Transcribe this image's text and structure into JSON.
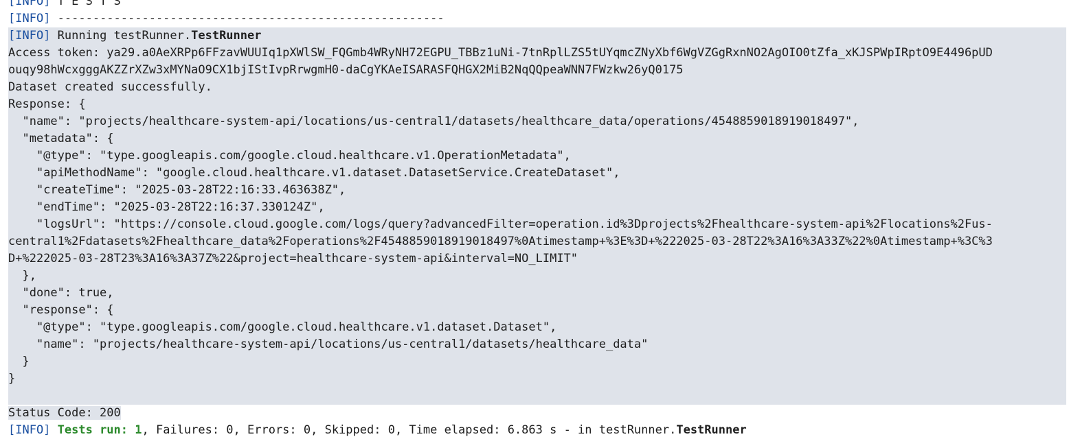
{
  "console": {
    "info_tag": "[INFO]",
    "header_tests": " T E S T S",
    "header_rule": " -------------------------------------------------------",
    "running_prefix": " Running testRunner.",
    "running_class": "TestRunner",
    "lines": [
      "Access token: ya29.a0AeXRPp6FFzavWUUIq1pXWlSW_FQGmb4WRyNH72EGPU_TBBz1uNi-7tnRplLZS5tUYqmcZNyXbf6WgVZGgRxnNO2AgOIO0tZfa_xKJSPWpIRptO9E4496pUD",
      "ouqy98hWcxgggAKZZrXZw3xMYNaO9CX1bjIStIvpRrwgmH0-daCgYKAeISARASFQHGX2MiB2NqQQpeaWNN7FWzkw26yQ0175",
      "Dataset created successfully.",
      "Response: {",
      "  \"name\": \"projects/healthcare-system-api/locations/us-central1/datasets/healthcare_data/operations/4548859018919018497\",",
      "  \"metadata\": {",
      "    \"@type\": \"type.googleapis.com/google.cloud.healthcare.v1.OperationMetadata\",",
      "    \"apiMethodName\": \"google.cloud.healthcare.v1.dataset.DatasetService.CreateDataset\",",
      "    \"createTime\": \"2025-03-28T22:16:33.463638Z\",",
      "    \"endTime\": \"2025-03-28T22:16:37.330124Z\",",
      "    \"logsUrl\": \"https://console.cloud.google.com/logs/query?advancedFilter=operation.id%3Dprojects%2Fhealthcare-system-api%2Flocations%2Fus-",
      "central1%2Fdatasets%2Fhealthcare_data%2Foperations%2F4548859018919018497%0Atimestamp+%3E%3D+%222025-03-28T22%3A16%3A33Z%22%0Atimestamp+%3C%3",
      "D+%222025-03-28T23%3A16%3A37Z%22&project=healthcare-system-api&interval=NO_LIMIT\"",
      "  },",
      "  \"done\": true,",
      "  \"response\": {",
      "    \"@type\": \"type.googleapis.com/google.cloud.healthcare.v1.dataset.Dataset\",",
      "    \"name\": \"projects/healthcare-system-api/locations/us-central1/datasets/healthcare_data\"",
      "  }",
      "}",
      ""
    ],
    "status_line": "Status Code: 200",
    "summary": {
      "label": " Tests run: 1",
      "rest": ", Failures: 0, Errors: 0, Skipped: 0, Time elapsed: 6.863 s - in testRunner.",
      "class_name": "TestRunner"
    }
  }
}
